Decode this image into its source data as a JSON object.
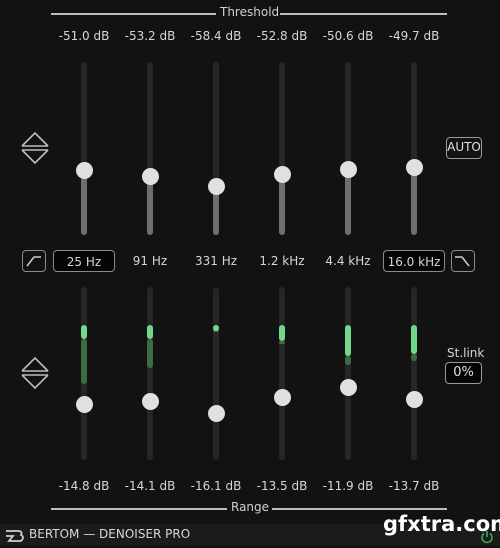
{
  "threshold": {
    "title": "Threshold",
    "bands": [
      {
        "value_label": "-51.0 dB",
        "level": 0.37
      },
      {
        "value_label": "-53.2 dB",
        "level": 0.34
      },
      {
        "value_label": "-58.4 dB",
        "level": 0.28
      },
      {
        "value_label": "-52.8 dB",
        "level": 0.35
      },
      {
        "value_label": "-50.6 dB",
        "level": 0.38
      },
      {
        "value_label": "-49.7 dB",
        "level": 0.39
      }
    ],
    "auto_label": "AUTO"
  },
  "frequencies": {
    "low_cut_icon": "low-cut-filter-icon",
    "high_cut_icon": "high-cut-filter-icon",
    "bands": [
      {
        "label": "25 Hz",
        "editable": true
      },
      {
        "label": "91 Hz",
        "editable": false
      },
      {
        "label": "331 Hz",
        "editable": false
      },
      {
        "label": "1.2 kHz",
        "editable": false
      },
      {
        "label": "4.4 kHz",
        "editable": false
      },
      {
        "label": "16.0 kHz",
        "editable": true
      }
    ]
  },
  "range": {
    "title": "Range",
    "bands": [
      {
        "value_label": "-14.8 dB",
        "level": 0.32,
        "meter_bright": [
          0.78,
          0.7
        ],
        "meter_dim": [
          0.7,
          0.44
        ]
      },
      {
        "value_label": "-14.1 dB",
        "level": 0.34,
        "meter_bright": [
          0.78,
          0.7
        ],
        "meter_dim": [
          0.7,
          0.53
        ]
      },
      {
        "value_label": "-16.1 dB",
        "level": 0.27,
        "meter_bright": [
          0.78,
          0.76
        ],
        "meter_dim": [
          0.76,
          0.74
        ]
      },
      {
        "value_label": "-13.5 dB",
        "level": 0.36,
        "meter_bright": [
          0.78,
          0.69
        ],
        "meter_dim": [
          0.69,
          0.67
        ]
      },
      {
        "value_label": "-11.9 dB",
        "level": 0.42,
        "meter_bright": [
          0.78,
          0.6
        ],
        "meter_dim": [
          0.6,
          0.55
        ]
      },
      {
        "value_label": "-13.7 dB",
        "level": 0.35,
        "meter_bright": [
          0.78,
          0.61
        ],
        "meter_dim": [
          0.61,
          0.57
        ]
      }
    ],
    "stereo_link": {
      "label": "St.link",
      "value": "0%"
    }
  },
  "footer": {
    "brand": "BERTOM — DENOISER PRO",
    "logo_icon": "bertom-logo-icon",
    "power_icon": "power-icon",
    "power_color": "#3fae5a",
    "watermark": "gfxtra.com"
  },
  "colors": {
    "meter_bright": "#72d88a",
    "meter_dim": "#3e6b45",
    "background": "#121212"
  }
}
